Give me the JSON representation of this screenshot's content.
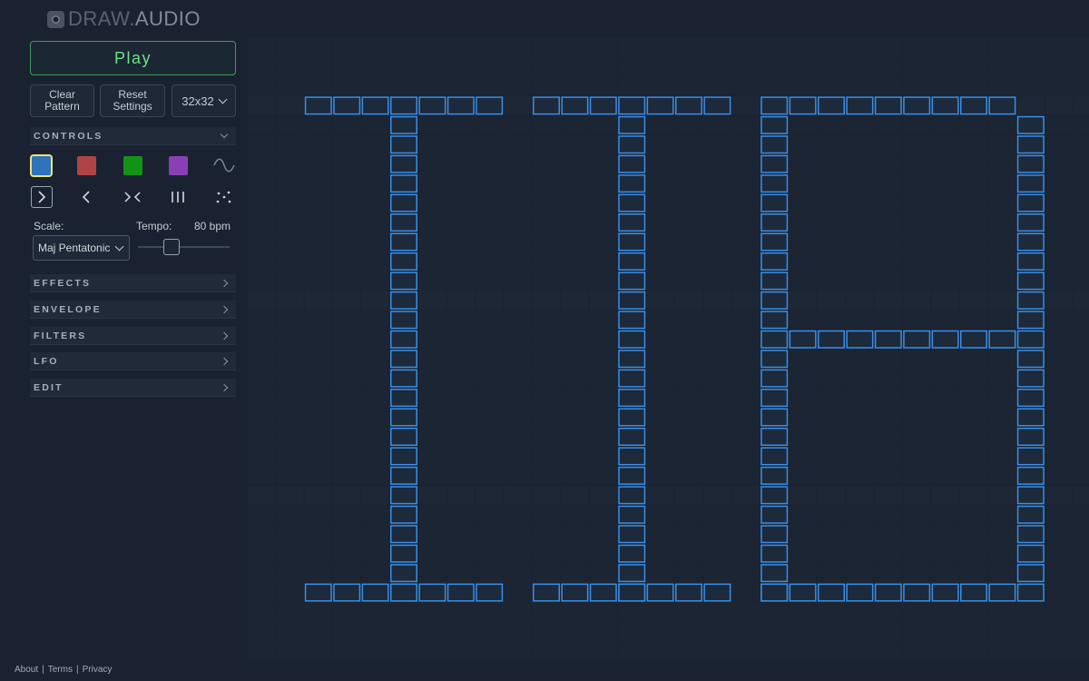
{
  "app": {
    "logo_bold": "DRAW",
    "logo_dot": ".",
    "logo_light": "AUDIO"
  },
  "transport": {
    "play_label": "Play"
  },
  "buttons": {
    "clear_line1": "Clear",
    "clear_line2": "Pattern",
    "reset_line1": "Reset",
    "reset_line2": "Settings",
    "grid_size": "32x32"
  },
  "controls": {
    "header": "CONTROLS",
    "swatches": [
      {
        "name": "blue",
        "color": "#2f74b8",
        "selected": true
      },
      {
        "name": "red",
        "color": "#b04343",
        "selected": false
      },
      {
        "name": "green",
        "color": "#129318",
        "selected": false
      },
      {
        "name": "purple",
        "color": "#8a3fb7",
        "selected": false
      }
    ],
    "waveform_icon": "sine-wave-icon",
    "tools": [
      "play-right-icon",
      "play-left-icon",
      "converge-icon",
      "bars-icon",
      "random-dots-icon"
    ],
    "scale_label": "Scale:",
    "scale_value": "Maj Pentatonic",
    "tempo_label": "Tempo:",
    "tempo_value": "80 bpm",
    "tempo_fraction": 0.37
  },
  "sections": [
    "EFFECTS",
    "ENVELOPE",
    "FILTERS",
    "LFO",
    "EDIT"
  ],
  "footer": {
    "about": "About",
    "sep1": "|",
    "terms": "Terms",
    "sep2": "|",
    "privacy": "Privacy"
  },
  "grid": {
    "size": 32,
    "active_color": "#3a8ee6",
    "active_cells": [
      "2,3",
      "3,3",
      "4,3",
      "5,3",
      "6,3",
      "7,3",
      "8,3",
      "10,3",
      "11,3",
      "12,3",
      "13,3",
      "14,3",
      "15,3",
      "16,3",
      "18,3",
      "19,3",
      "20,3",
      "21,3",
      "22,3",
      "23,3",
      "24,3",
      "25,3",
      "26,3",
      "5,4",
      "5,5",
      "5,6",
      "5,7",
      "5,8",
      "5,9",
      "5,10",
      "5,11",
      "5,12",
      "5,13",
      "5,14",
      "5,15",
      "5,16",
      "5,17",
      "5,18",
      "5,19",
      "5,20",
      "5,21",
      "5,22",
      "5,23",
      "5,24",
      "5,25",
      "5,26",
      "5,27",
      "5,28",
      "13,4",
      "13,5",
      "13,6",
      "13,7",
      "13,8",
      "13,9",
      "13,10",
      "13,11",
      "13,12",
      "13,13",
      "13,14",
      "13,15",
      "13,16",
      "13,17",
      "13,18",
      "13,19",
      "13,20",
      "13,21",
      "13,22",
      "13,23",
      "13,24",
      "13,25",
      "13,26",
      "13,27",
      "13,28",
      "18,4",
      "18,5",
      "18,6",
      "18,7",
      "18,8",
      "18,9",
      "18,10",
      "18,11",
      "18,12",
      "18,13",
      "18,14",
      "18,15",
      "18,16",
      "18,17",
      "18,18",
      "18,19",
      "18,20",
      "18,21",
      "18,22",
      "18,23",
      "18,24",
      "18,25",
      "18,26",
      "18,27",
      "18,28",
      "27,4",
      "27,5",
      "27,6",
      "27,7",
      "27,8",
      "27,9",
      "27,10",
      "27,11",
      "27,12",
      "27,13",
      "27,14",
      "27,15",
      "27,16",
      "27,17",
      "27,18",
      "27,19",
      "27,20",
      "27,21",
      "27,22",
      "27,23",
      "27,24",
      "27,25",
      "27,26",
      "27,27",
      "27,28",
      "19,15",
      "20,15",
      "21,15",
      "22,15",
      "23,15",
      "24,15",
      "25,15",
      "26,15",
      "2,28",
      "3,28",
      "4,28",
      "5,28",
      "6,28",
      "7,28",
      "8,28",
      "10,28",
      "11,28",
      "12,28",
      "13,28",
      "14,28",
      "15,28",
      "16,28",
      "18,28",
      "19,28",
      "20,28",
      "21,28",
      "22,28",
      "23,28",
      "24,28",
      "25,28",
      "26,28"
    ]
  }
}
